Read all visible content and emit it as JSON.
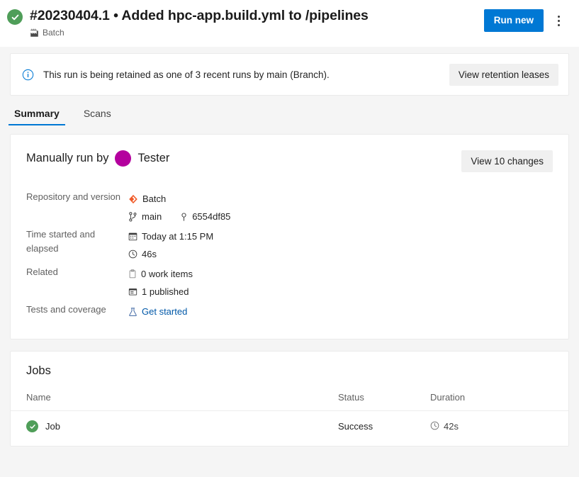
{
  "header": {
    "status_icon": "success-check-icon",
    "title": "#20230404.1 • Added hpc-app.build.yml to /pipelines",
    "subtitle": "Batch",
    "subtitle_icon": "factory-build-icon",
    "run_new_label": "Run new",
    "more_actions_icon": "kebab-menu-icon",
    "accent_color": "#0078d4",
    "success_color": "#4f9e59"
  },
  "banner": {
    "icon": "info-circle-icon",
    "message": "This run is being retained as one of 3 recent runs by main (Branch).",
    "action_label": "View retention leases"
  },
  "tabs": [
    {
      "label": "Summary",
      "active": true
    },
    {
      "label": "Scans",
      "active": false
    }
  ],
  "summary": {
    "run_by_prefix": "Manually run by",
    "run_by_user": "Tester",
    "avatar_color": "#b4009e",
    "changes_button": "View 10 changes",
    "details": [
      {
        "label": "Repository and version",
        "values": [
          {
            "icon": "azure-repos-diamond-icon",
            "text": "Batch"
          }
        ],
        "inline_values": [
          {
            "icon": "branch-icon",
            "text": "main"
          },
          {
            "icon": "commit-icon",
            "text": "6554df85"
          }
        ]
      },
      {
        "label": "Time started and elapsed",
        "values": [
          {
            "icon": "calendar-icon",
            "text": "Today at 1:15 PM"
          },
          {
            "icon": "clock-icon",
            "text": "46s"
          }
        ]
      },
      {
        "label": "Related",
        "values": [
          {
            "icon": "work-item-icon",
            "text": "0 work items"
          },
          {
            "icon": "artifact-icon",
            "text": "1 published"
          }
        ]
      },
      {
        "label": "Tests and coverage",
        "values": [
          {
            "icon": "beaker-icon",
            "text": "Get started",
            "link": true
          }
        ]
      }
    ]
  },
  "jobs": {
    "title": "Jobs",
    "columns": [
      "Name",
      "Status",
      "Duration"
    ],
    "rows": [
      {
        "status_icon": "success-check-icon",
        "name": "Job",
        "status": "Success",
        "duration_icon": "clock-icon",
        "duration": "42s"
      }
    ]
  }
}
